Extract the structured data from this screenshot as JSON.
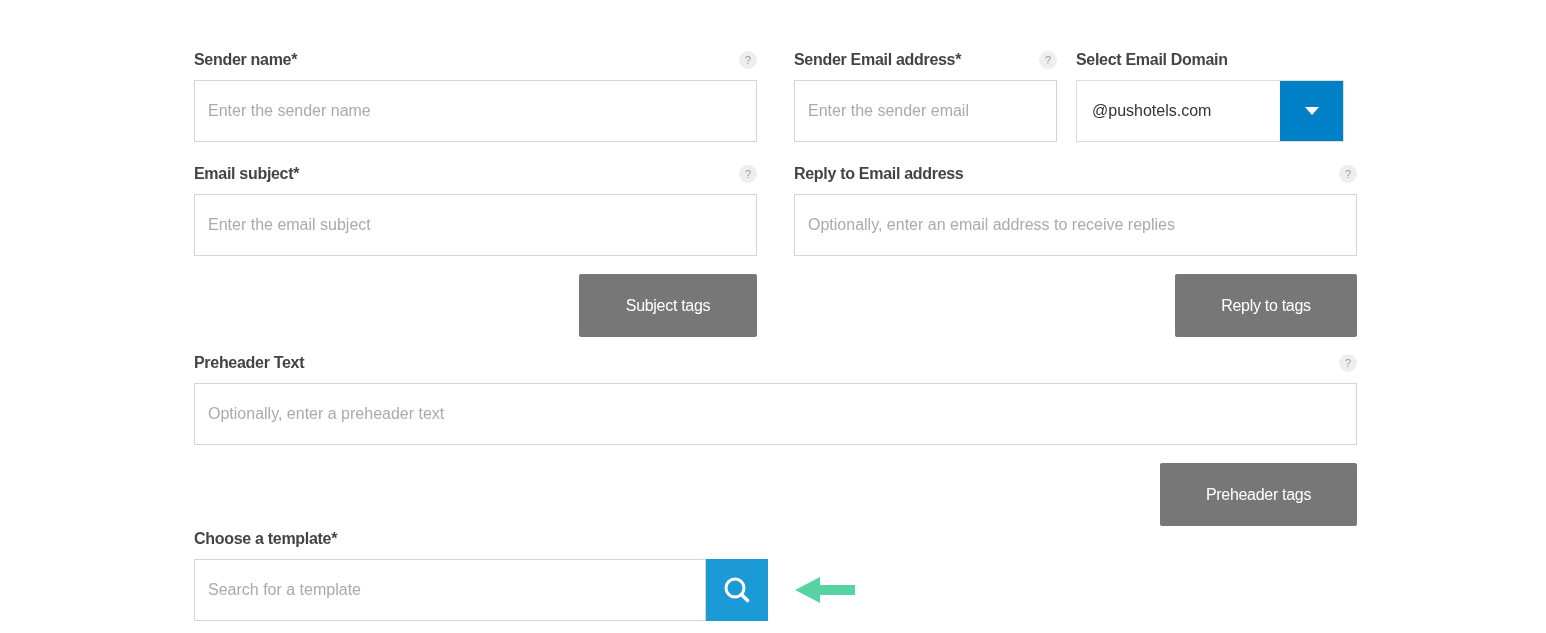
{
  "sender_name": {
    "label": "Sender name*",
    "placeholder": "Enter the sender name",
    "help": "?"
  },
  "sender_email": {
    "label": "Sender Email address*",
    "placeholder": "Enter the sender email",
    "help": "?"
  },
  "email_domain": {
    "label": "Select Email Domain",
    "value": "@pushotels.com"
  },
  "email_subject": {
    "label": "Email subject*",
    "placeholder": "Enter the email subject",
    "help": "?"
  },
  "reply_to": {
    "label": "Reply to Email address",
    "placeholder": "Optionally, enter an email address to receive replies",
    "help": "?"
  },
  "subject_tags_button": "Subject tags",
  "reply_tags_button": "Reply to tags",
  "preheader": {
    "label": "Preheader Text",
    "placeholder": "Optionally, enter a preheader text",
    "help": "?"
  },
  "preheader_tags_button": "Preheader tags",
  "template": {
    "label": "Choose a template*",
    "placeholder": "Search for a template"
  }
}
